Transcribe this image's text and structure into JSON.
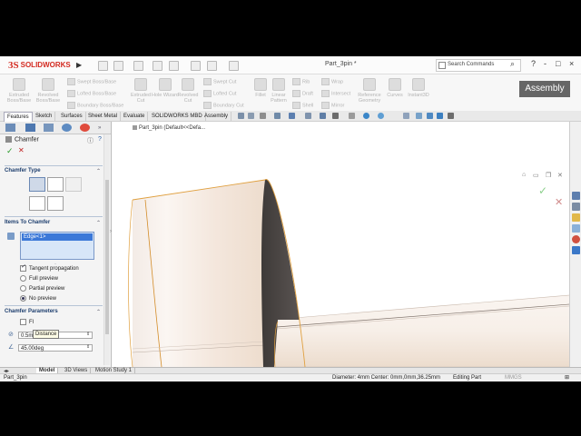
{
  "app": {
    "brand_prefix": "3S",
    "brand": "SOLIDWORKS",
    "document_title": "Part_3pin *",
    "search_placeholder": "Search Commands",
    "window_controls": [
      "?",
      "-",
      "□",
      "×"
    ]
  },
  "command_manager": {
    "big_buttons": [
      {
        "label": "Extruded Boss/Base"
      },
      {
        "label": "Revolved Boss/Base"
      },
      {
        "label": "Extruded Cut"
      },
      {
        "label": "Hole Wizard"
      },
      {
        "label": "Revolved Cut"
      },
      {
        "label": "Fillet"
      },
      {
        "label": "Linear Pattern"
      },
      {
        "label": "Reference Geometry"
      },
      {
        "label": "Curves"
      },
      {
        "label": "Instant3D"
      }
    ],
    "small_buttons": [
      {
        "label": "Swept Boss/Base"
      },
      {
        "label": "Lofted Boss/Base"
      },
      {
        "label": "Boundary Boss/Base"
      },
      {
        "label": "Swept Cut"
      },
      {
        "label": "Lofted Cut"
      },
      {
        "label": "Boundary Cut"
      },
      {
        "label": "Rib"
      },
      {
        "label": "Draft"
      },
      {
        "label": "Shell"
      },
      {
        "label": "Wrap"
      },
      {
        "label": "Intersect"
      },
      {
        "label": "Mirror"
      }
    ],
    "badge": "Assembly"
  },
  "tabs": [
    {
      "label": "Features"
    },
    {
      "label": "Sketch"
    },
    {
      "label": "Surfaces"
    },
    {
      "label": "Sheet Metal"
    },
    {
      "label": "Evaluate"
    },
    {
      "label": "SOLIDWORKS MBD"
    },
    {
      "label": "Assembly"
    }
  ],
  "property_manager": {
    "title": "Chamfer",
    "ok_symbol": "✓",
    "cancel_symbol": "✕",
    "sections": {
      "chamfer_type": "Chamfer Type",
      "items": "Items To Chamfer",
      "parameters": "Chamfer Parameters"
    },
    "selected_item": "Edge<1>",
    "options": [
      {
        "label": "Tangent propagation",
        "kind": "checkbox",
        "checked": true
      },
      {
        "label": "Full preview",
        "kind": "radio",
        "checked": false
      },
      {
        "label": "Partial preview",
        "kind": "radio",
        "checked": false
      },
      {
        "label": "No preview",
        "kind": "radio",
        "checked": true
      }
    ],
    "flip_label": "Fl",
    "tooltip": "Distance",
    "distance_value": "0.5mm",
    "angle_value": "45.00deg"
  },
  "viewport": {
    "tree_label": "Part_3pin (Default<<Defa..."
  },
  "bottom_tabs": [
    {
      "label": "Model"
    },
    {
      "label": "3D Views"
    },
    {
      "label": "Motion Study 1"
    }
  ],
  "status": {
    "left": "Part_3pin",
    "measure": "Diameter: 4mm  Center: 0mm,0mm,36.25mm",
    "mode": "Editing Part",
    "units": "MMGS"
  },
  "colors": {
    "accent": "#3b78d8",
    "brand": "#d32a20",
    "highlight_edge": "#f0a020"
  }
}
